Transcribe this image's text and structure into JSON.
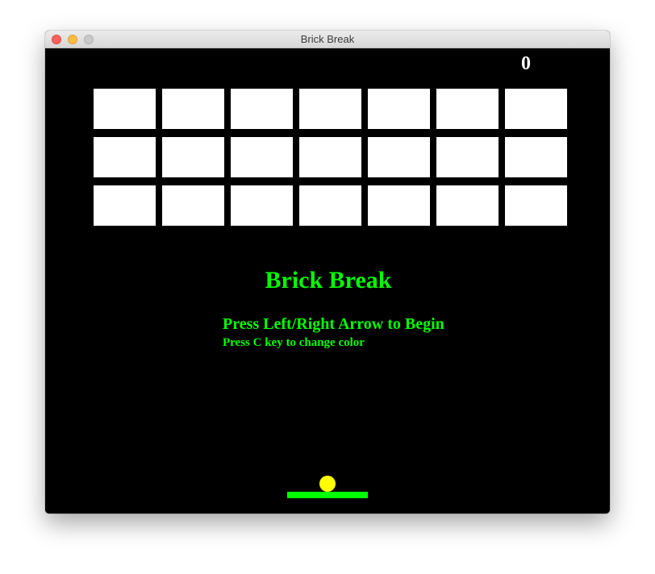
{
  "window": {
    "title": "Brick Break"
  },
  "game": {
    "score": "0",
    "title": "Brick Break",
    "instruction_primary": "Press Left/Right Arrow to Begin",
    "instruction_secondary": "Press C key to change color",
    "brick_rows": 3,
    "brick_cols": 7,
    "bricks_remaining": 21
  },
  "colors": {
    "background": "#000000",
    "brick": "#ffffff",
    "text_accent": "#00ff00",
    "paddle": "#00ff00",
    "ball": "#ffff00",
    "score": "#ffffff"
  }
}
